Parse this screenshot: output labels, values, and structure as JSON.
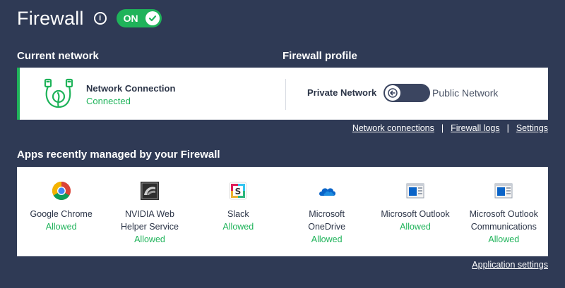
{
  "header": {
    "title": "Firewall",
    "toggle_label": "ON"
  },
  "current_network": {
    "label": "Current network",
    "name": "Network Connection",
    "status": "Connected"
  },
  "firewall_profile": {
    "label": "Firewall profile",
    "private": "Private Network",
    "public": "Public Network"
  },
  "links": {
    "network_connections": "Network connections",
    "sep1": "|",
    "firewall_logs": "Firewall logs",
    "sep2": "|",
    "settings": "Settings"
  },
  "apps": {
    "label": "Apps recently managed by your Firewall",
    "items": [
      {
        "name_lines": [
          "Google Chrome"
        ],
        "status": "Allowed",
        "icon": "chrome-icon"
      },
      {
        "name_lines": [
          "NVIDIA Web",
          "Helper Service"
        ],
        "status": "Allowed",
        "icon": "nvidia-icon"
      },
      {
        "name_lines": [
          "Slack"
        ],
        "status": "Allowed",
        "icon": "slack-icon"
      },
      {
        "name_lines": [
          "Microsoft",
          "OneDrive"
        ],
        "status": "Allowed",
        "icon": "onedrive-icon"
      },
      {
        "name_lines": [
          "Microsoft Outlook"
        ],
        "status": "Allowed",
        "icon": "outlook-icon"
      },
      {
        "name_lines": [
          "Microsoft Outlook",
          "Communications"
        ],
        "status": "Allowed",
        "icon": "outlook-communications-icon"
      }
    ],
    "settings_link": "Application settings"
  },
  "colors": {
    "background": "#2f3a55",
    "accent": "#1fb35a",
    "card": "#ffffff"
  }
}
